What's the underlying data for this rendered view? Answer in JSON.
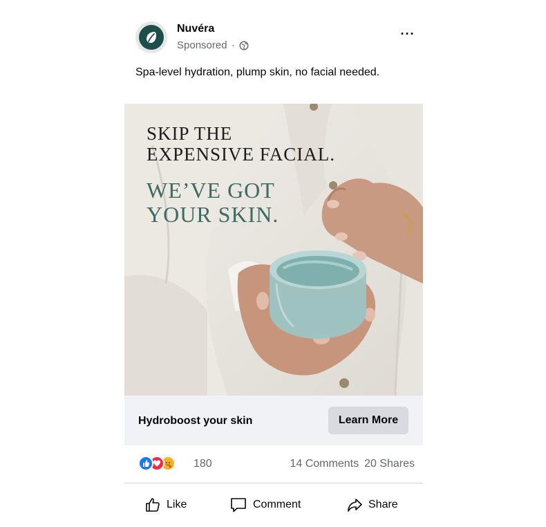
{
  "post": {
    "page_name": "Nuvéra",
    "sponsored_label": "Sponsored",
    "separator": "·",
    "caption": "Spa-level hydration, plump skin, no facial needed.",
    "more_label": "···"
  },
  "ad": {
    "headline_lines": [
      "SKIP THE",
      "EXPENSIVE FACIAL."
    ],
    "subhead_lines": [
      "WE’VE GOT",
      "YOUR SKIN."
    ],
    "colors": {
      "subhead": "#3f6a63",
      "brand": "#1f4d4a"
    }
  },
  "cta": {
    "title": "Hydroboost your skin",
    "button_label": "Learn More"
  },
  "stats": {
    "reactions": [
      "like-icon",
      "love-icon",
      "care-icon"
    ],
    "reaction_count": "180",
    "comments": "14 Comments",
    "shares": "20 Shares"
  },
  "actions": {
    "like_label": "Like",
    "comment_label": "Comment",
    "share_label": "Share"
  }
}
